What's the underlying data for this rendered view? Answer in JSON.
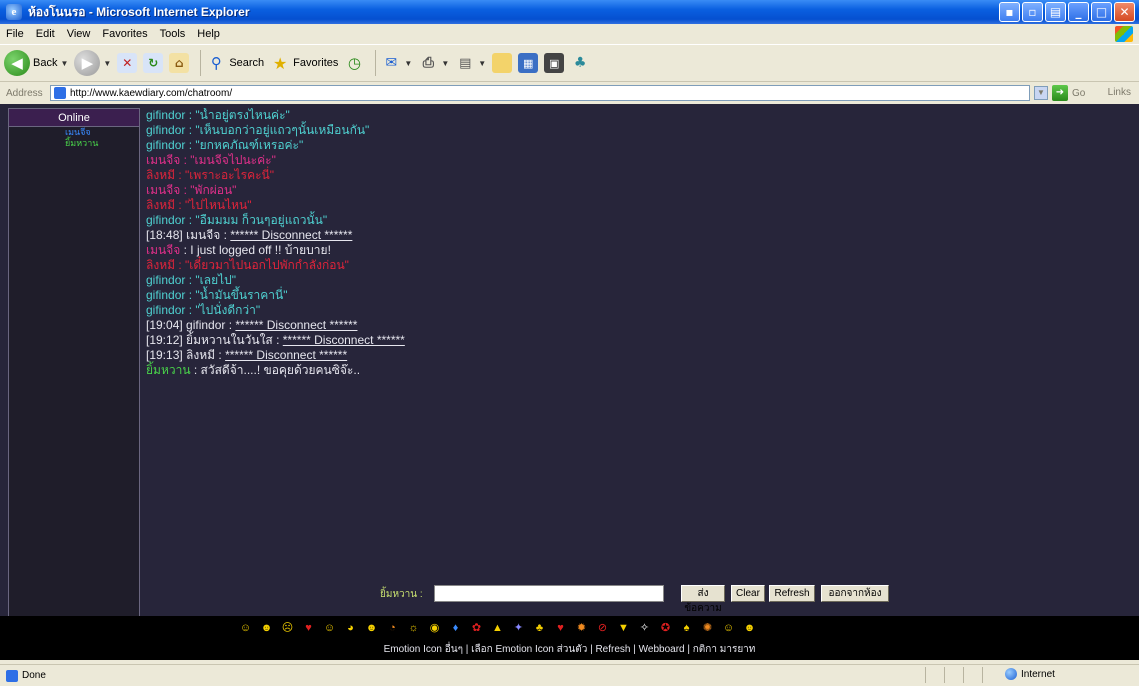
{
  "window": {
    "title": "ห้องโนนรอ - Microsoft Internet Explorer"
  },
  "menu": [
    "File",
    "Edit",
    "View",
    "Favorites",
    "Tools",
    "Help"
  ],
  "toolbar": {
    "back_label": "Back",
    "search_label": "Search",
    "favorites_label": "Favorites"
  },
  "address": {
    "label": "Address",
    "url": "http://www.kaewdiary.com/chatroom/",
    "go_label": "Go",
    "links_label": "Links"
  },
  "online": {
    "title": "Online",
    "users": [
      {
        "name": "เมนจีจ",
        "color": "#3a8cff"
      },
      {
        "name": "ยิ้มหวาน",
        "color": "#49d24a"
      }
    ]
  },
  "chat": [
    {
      "name": "gifindor",
      "text": " : \"น้ำอยู่ตรงไหนค่ะ\"",
      "name_color": "#4fd1d1",
      "text_color": "#4fd1d1"
    },
    {
      "name": "gifindor",
      "text": " : \"เห็นบอกว่าอยู่แถวๆนั้นเหมือนกัน\"",
      "name_color": "#4fd1d1",
      "text_color": "#4fd1d1"
    },
    {
      "name": "gifindor",
      "text": " : \"ยกหคภัณฑ์เหรอค่ะ\"",
      "name_color": "#4fd1d1",
      "text_color": "#4fd1d1"
    },
    {
      "name": "เมนจีจ",
      "text": " : \"เมนจีจไปนะค่ะ\"",
      "name_color": "#e0308a",
      "text_color": "#e0308a"
    },
    {
      "name": "ลิงหมี",
      "text": " : \"เพราะอะไรคะนี่\"",
      "name_color": "#e0243a",
      "text_color": "#e0243a"
    },
    {
      "name": "เมนจีจ",
      "text": " : \"พักผ่อน\"",
      "name_color": "#e0308a",
      "text_color": "#e0308a"
    },
    {
      "name": "ลิงหมี",
      "text": " : \"ไปไหนไหน\"",
      "name_color": "#e0243a",
      "text_color": "#e0243a"
    },
    {
      "name": "gifindor",
      "text": " : \"อืมมมม ก็วนๆอยู่แถวนั้น\"",
      "name_color": "#4fd1d1",
      "text_color": "#4fd1d1"
    },
    {
      "prefix": "[18:48] เมนจีจ : ",
      "sys": "****** Disconnect ******",
      "text_color": "#e6e6ee"
    },
    {
      "name": "เมนจีจ",
      "text": " : I just logged off !! บ้ายบาย!",
      "name_color": "#e0308a",
      "text_color": "#e6e6ee"
    },
    {
      "name": "ลิงหมี",
      "text": " : \"เดี๋ยวมาไปนอกไปพักกำลังก่อน\"",
      "name_color": "#e0243a",
      "text_color": "#e0243a"
    },
    {
      "name": "gifindor",
      "text": " : \"เลยไป\"",
      "name_color": "#4fd1d1",
      "text_color": "#4fd1d1"
    },
    {
      "name": "gifindor",
      "text": " : \"น้ำมันขึ้นราคานี่\"",
      "name_color": "#4fd1d1",
      "text_color": "#4fd1d1"
    },
    {
      "name": "gifindor",
      "text": " : \"ไปนั่งดีกว่า\"",
      "name_color": "#4fd1d1",
      "text_color": "#4fd1d1"
    },
    {
      "prefix": "[19:04] gifindor : ",
      "sys": "****** Disconnect ******",
      "text_color": "#e6e6ee"
    },
    {
      "prefix": "[19:12] ยิ้มหวานในวันใส : ",
      "sys": "****** Disconnect ******",
      "text_color": "#e6e6ee"
    },
    {
      "prefix": "[19:13] ลิงหมี : ",
      "sys": "****** Disconnect ******",
      "text_color": "#e6e6ee"
    },
    {
      "name": "ยิ้มหวาน",
      "text": " : สวัสดีจ้า....! ขอคุยด้วยคนซิจ๊ะ..",
      "name_color": "#49d24a",
      "text_color": "#e6e6ee"
    }
  ],
  "input": {
    "label": "ยิ้มหวาน :",
    "value": "",
    "send_label": "ส่งข้อความ",
    "clear_label": "Clear",
    "refresh_label": "Refresh",
    "leave_label": "ออกจากห้อง"
  },
  "emoji_links": "Emotion Icon อื่นๆ | เลือก Emotion Icon ส่วนตัว | Refresh | Webboard | กติกา มารยาท",
  "status": {
    "text": "Done",
    "zone": "Internet"
  }
}
